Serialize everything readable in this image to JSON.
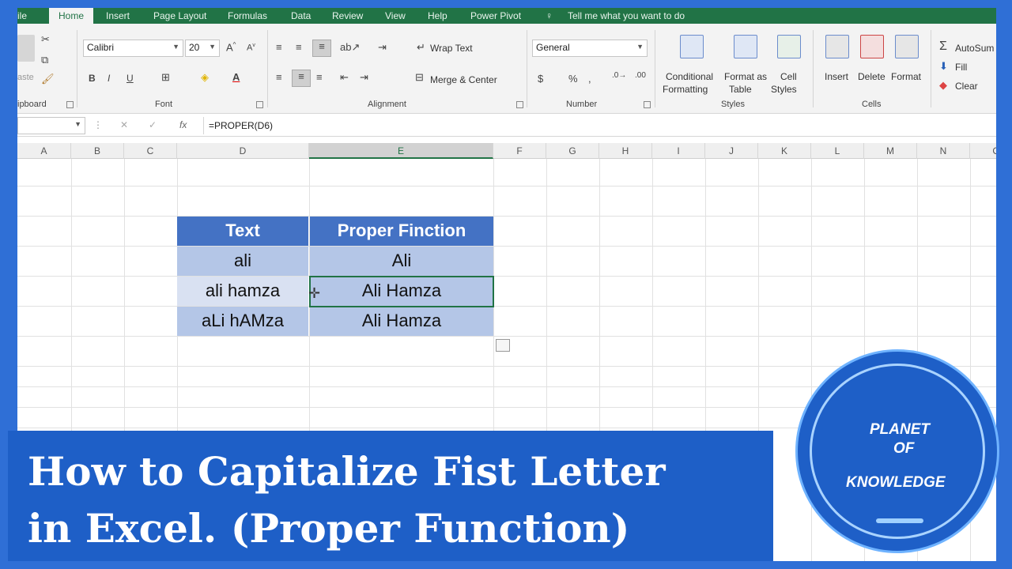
{
  "tabs": [
    "ile",
    "Home",
    "Insert",
    "Page Layout",
    "Formulas",
    "Data",
    "Review",
    "View",
    "Help",
    "Power Pivot",
    "Tell me what you want to do"
  ],
  "ribbon": {
    "clipboard_label": "ipboard",
    "paste_label": "aste",
    "font_name": "Calibri",
    "font_size": "20",
    "font_label": "Font",
    "wrap_text": "Wrap Text",
    "merge_center": "Merge & Center",
    "alignment_label": "Alignment",
    "number_format": "General",
    "number_label": "Number",
    "conditional_1": "Conditional",
    "conditional_2": "Formatting",
    "format_table_1": "Format as",
    "format_table_2": "Table",
    "cell_styles_1": "Cell",
    "cell_styles_2": "Styles",
    "styles_label": "Styles",
    "insert": "Insert",
    "delete": "Delete",
    "format": "Format",
    "cells_label": "Cells",
    "autosum": "AutoSum",
    "fill": "Fill",
    "clear": "Clear"
  },
  "formula_bar": {
    "formula": "=PROPER(D6)"
  },
  "columns": [
    "A",
    "B",
    "C",
    "D",
    "E",
    "F",
    "G",
    "H",
    "I",
    "J",
    "K",
    "L",
    "M",
    "N",
    "O"
  ],
  "table": {
    "headers": [
      "Text",
      "Proper Finction"
    ],
    "rows": [
      [
        "ali",
        "Ali"
      ],
      [
        "ali hamza",
        "Ali Hamza"
      ],
      [
        "aLi hAMza",
        "Ali Hamza"
      ]
    ]
  },
  "banner": {
    "line1": "How to Capitalize Fist Letter",
    "line2": "in Excel. (Proper Function)"
  },
  "logo": {
    "line1": "PLANET",
    "line2": "OF",
    "line3": "KNOWLEDGE"
  },
  "colors": {
    "excel_green": "#217346",
    "header_blue": "#4472c4",
    "band_light": "#d9e1f2",
    "band_mid": "#b4c6e7",
    "banner_blue": "#1e5fc7"
  }
}
